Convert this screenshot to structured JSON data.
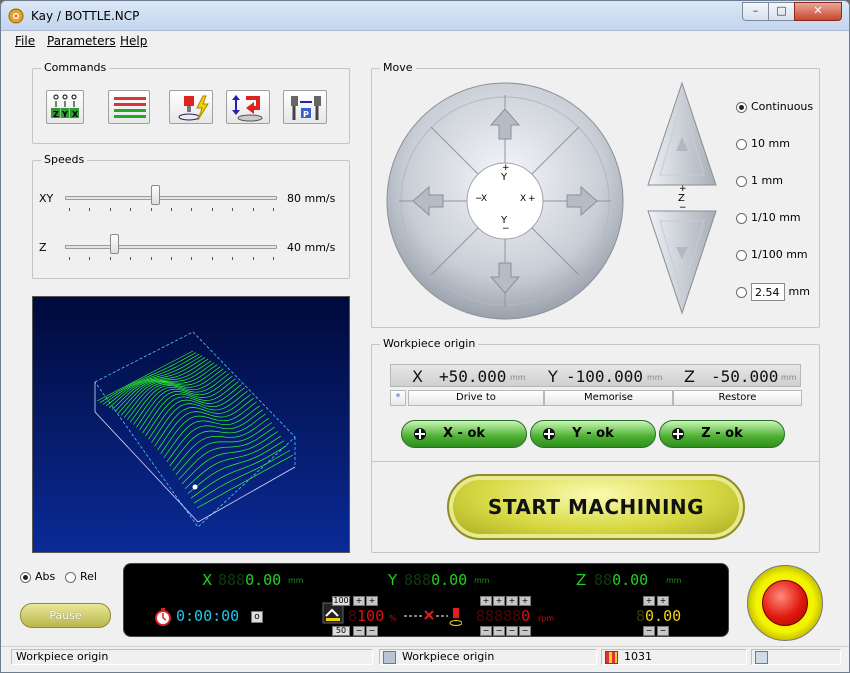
{
  "window": {
    "title": "Kay / BOTTLE.NCP",
    "minimize": "–",
    "maximize": "□",
    "close": "✕"
  },
  "menu": [
    {
      "label": "File"
    },
    {
      "label": "Parameters"
    },
    {
      "label": "Help"
    }
  ],
  "commands": {
    "label": "Commands"
  },
  "speeds": {
    "label": "Speeds",
    "xy": {
      "label": "XY",
      "value": "80 mm/s",
      "level": 0.42
    },
    "z": {
      "label": "Z",
      "value": "40 mm/s",
      "level": 0.22
    }
  },
  "move": {
    "label": "Move",
    "wheel_labels": {
      "y_plus": "Y",
      "y_minus": "Y",
      "x_minus": "X",
      "x_plus": "X",
      "z": "Z",
      "plus": "+",
      "minus": "−"
    },
    "steps": [
      {
        "label": "Continuous",
        "selected": true
      },
      {
        "label": "10 mm",
        "selected": false
      },
      {
        "label": "1 mm",
        "selected": false
      },
      {
        "label": "1/10 mm",
        "selected": false
      },
      {
        "label": "1/100 mm",
        "selected": false
      },
      {
        "label": "mm",
        "selected": false,
        "input": "2.54"
      }
    ]
  },
  "workpiece_origin": {
    "label": "Workpiece origin",
    "x": {
      "axis": "X",
      "value": "+50.000",
      "unit": "mm"
    },
    "y": {
      "axis": "Y",
      "value": "-100.000",
      "unit": "mm"
    },
    "z": {
      "axis": "Z",
      "value": "-50.000",
      "unit": "mm"
    },
    "star": "*",
    "drive_to": "Drive to",
    "memorise": "Memorise",
    "restore": "Restore",
    "x_ok": "X - ok",
    "y_ok": "Y - ok",
    "z_ok": "Z - ok"
  },
  "start_button": "START  MACHINING",
  "mode": {
    "abs": "Abs",
    "rel": "Rel",
    "selected": "abs"
  },
  "pause": "Pause",
  "dro": {
    "x": {
      "axis": "X",
      "dim": "888",
      "value": "0.00",
      "unit": "mm"
    },
    "y": {
      "axis": "Y",
      "dim": "888",
      "value": "0.00",
      "unit": "mm"
    },
    "z": {
      "axis": "Z",
      "dim": "88",
      "value": "0.00",
      "unit": "mm"
    },
    "timer": "0:00:00",
    "timer_btn": "o",
    "feed_top": "100",
    "feed_bottom": "50",
    "feed_value": "100",
    "feed_unit": "%",
    "spindle_value": "0",
    "spindle_unit": "rpm",
    "z_offset": "0.00",
    "plus": "+",
    "minus": "−"
  },
  "statusbar": {
    "left": "Workpiece origin",
    "middle": "Workpiece origin",
    "right": "1031"
  }
}
